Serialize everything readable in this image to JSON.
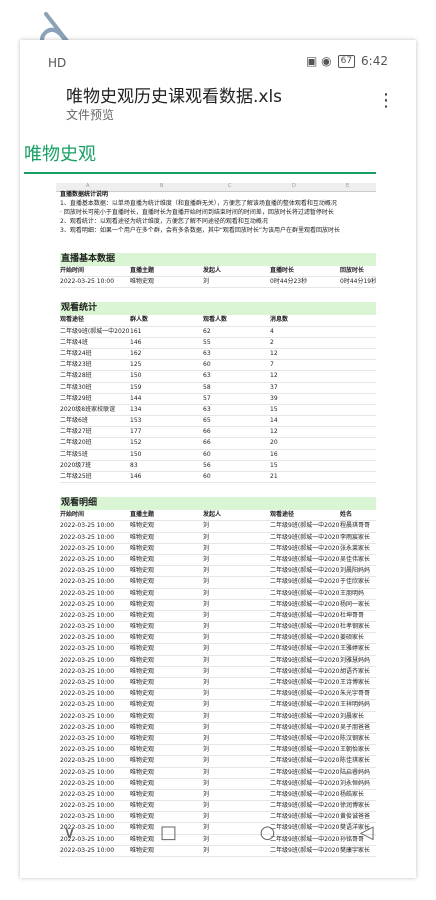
{
  "status": {
    "left": "HD",
    "right_icons": "▣ ◉",
    "battery": "67",
    "time": "6:42"
  },
  "header": {
    "title": "唯物史观历史课观看数据.xls",
    "subtitle": "文件预览",
    "more": "⋮"
  },
  "sheet": {
    "name": "唯物史观",
    "columns": [
      "A",
      "B",
      "C",
      "D",
      "E",
      "F"
    ]
  },
  "notes": {
    "title": "直播数据统计说明",
    "lines": [
      "1、直播基本数据：以单场直播为统计维度（和直播群无关），方便您了解该场直播的整体观看和互动概况",
      "· 回放时长可能小于直播时长，直播时长为直播开始时间到结束时间的时间差，回放时长将过滤暂停时长",
      "2、观看统计：以观看途径为统计维度，方便您了解不同途径的观看和互动概况",
      "3、观看明细：如果一个用户在多个群，会有多条数据，其中“观看回放时长”为该用户在群里观看回放时长"
    ]
  },
  "basic": {
    "section": "直播基本数据",
    "headers": [
      "开始时间",
      "直播主题",
      "发起人",
      "直播时长",
      "回放时长"
    ],
    "row": [
      "2022-03-25 10:00",
      "唯物史观",
      "刘",
      "0时44分23秒",
      "0时44分19秒"
    ]
  },
  "stats": {
    "section": "观看统计",
    "headers": [
      "观看途径",
      "群人数",
      "观看人数",
      "消息数"
    ],
    "rows": [
      [
        "二年级9班(郝城一中2020)",
        "161",
        "62",
        "4"
      ],
      [
        "二年级4班",
        "146",
        "55",
        "2"
      ],
      [
        "二年级24班",
        "162",
        "63",
        "12"
      ],
      [
        "二年级23班",
        "125",
        "60",
        "7"
      ],
      [
        "二年级28班",
        "150",
        "63",
        "12"
      ],
      [
        "二年级30班",
        "159",
        "58",
        "37"
      ],
      [
        "二年级29班",
        "144",
        "57",
        "39"
      ],
      [
        "2020级8班家校联谊",
        "134",
        "63",
        "15"
      ],
      [
        "二年级6班",
        "153",
        "65",
        "14"
      ],
      [
        "二年级27班",
        "177",
        "66",
        "12"
      ],
      [
        "二年级20班",
        "152",
        "66",
        "20"
      ],
      [
        "二年级5班",
        "150",
        "60",
        "16"
      ],
      [
        "2020级7班",
        "83",
        "56",
        "15"
      ],
      [
        "二年级25班",
        "146",
        "60",
        "21"
      ]
    ]
  },
  "detail": {
    "section": "观看明细",
    "headers": [
      "开始时间",
      "直播主题",
      "发起人",
      "观看途径",
      "姓名"
    ],
    "rows": [
      [
        "2022-03-25 10:00",
        "唯物史观",
        "刘",
        "二年级9班(郝城一中2020)",
        "程晨琪哥哥"
      ],
      [
        "2022-03-25 10:00",
        "唯物史观",
        "刘",
        "二年级9班(郝城一中2020)",
        "李雨宸家长"
      ],
      [
        "2022-03-25 10:00",
        "唯物史观",
        "刘",
        "二年级9班(郝城一中2020)",
        "张永莱家长"
      ],
      [
        "2022-03-25 10:00",
        "唯物史观",
        "刘",
        "二年级9班(郝城一中2020)",
        "吴佳伟家长"
      ],
      [
        "2022-03-25 10:00",
        "唯物史观",
        "刘",
        "二年级9班(郝城一中2020)",
        "刘晨阳妈妈"
      ],
      [
        "2022-03-25 10:00",
        "唯物史观",
        "刘",
        "二年级9班(郝城一中2020)",
        "于佳欣家长"
      ],
      [
        "2022-03-25 10:00",
        "唯物史观",
        "刘",
        "二年级9班(郝城一中2020)",
        "王朋明妈"
      ],
      [
        "2022-03-25 10:00",
        "唯物史观",
        "刘",
        "二年级9班(郝城一中2020)",
        "杨同一家长"
      ],
      [
        "2022-03-25 10:00",
        "唯物史观",
        "刘",
        "二年级9班(郝城一中2020)",
        "杜坤哥哥"
      ],
      [
        "2022-03-25 10:00",
        "唯物史观",
        "刘",
        "二年级9班(郝城一中2020)",
        "杜孝钢家长"
      ],
      [
        "2022-03-25 10:00",
        "唯物史观",
        "刘",
        "二年级9班(郝城一中2020)",
        "姜硕家长"
      ],
      [
        "2022-03-25 10:00",
        "唯物史观",
        "刘",
        "二年级9班(郝城一中2020)",
        "王雅婷家长"
      ],
      [
        "2022-03-25 10:00",
        "唯物史观",
        "刘",
        "二年级9班(郝城一中2020)",
        "刘雅慧妈妈"
      ],
      [
        "2022-03-25 10:00",
        "唯物史观",
        "刘",
        "二年级9班(郝城一中2020)",
        "胡语齐家长"
      ],
      [
        "2022-03-25 10:00",
        "唯物史观",
        "刘",
        "二年级9班(郝城一中2020)",
        "王诗博家长"
      ],
      [
        "2022-03-25 10:00",
        "唯物史观",
        "刘",
        "二年级9班(郝城一中2020)",
        "朱光宇哥哥"
      ],
      [
        "2022-03-25 10:00",
        "唯物史观",
        "刘",
        "二年级9班(郝城一中2020)",
        "王祥明妈妈"
      ],
      [
        "2022-03-25 10:00",
        "唯物史观",
        "刘",
        "二年级9班(郝城一中2020)",
        "刘晨家长"
      ],
      [
        "2022-03-25 10:00",
        "唯物史观",
        "刘",
        "二年级9班(郝城一中2020)",
        "吴子朋爸爸"
      ],
      [
        "2022-03-25 10:00",
        "唯物史观",
        "刘",
        "二年级9班(郝城一中2020)",
        "陈汉钢家长"
      ],
      [
        "2022-03-25 10:00",
        "唯物史观",
        "刘",
        "二年级9班(郝城一中2020)",
        "王朝怡家长"
      ],
      [
        "2022-03-25 10:00",
        "唯物史观",
        "刘",
        "二年级9班(郝城一中2020)",
        "陈佳琪家长"
      ],
      [
        "2022-03-25 10:00",
        "唯物史观",
        "刘",
        "二年级9班(郝城一中2020)",
        "陆启睿妈妈"
      ],
      [
        "2022-03-25 10:00",
        "唯物史观",
        "刘",
        "二年级9班(郝城一中2020)",
        "刘永恒妈妈"
      ],
      [
        "2022-03-25 10:00",
        "唯物史观",
        "刘",
        "二年级9班(郝城一中2020)",
        "杨皓家长"
      ],
      [
        "2022-03-25 10:00",
        "唯物史观",
        "刘",
        "二年级9班(郝城一中2020)",
        "徐润博家长"
      ],
      [
        "2022-03-25 10:00",
        "唯物史观",
        "刘",
        "二年级9班(郝城一中2020)",
        "黄俊诚爸爸"
      ],
      [
        "2022-03-25 10:00",
        "唯物史观",
        "刘",
        "二年级9班(郝城一中2020)",
        "樊语洋家长"
      ],
      [
        "2022-03-25 10:00",
        "唯物史观",
        "刘",
        "二年级9班(郝城一中2020)",
        "孙铭哥哥"
      ],
      [
        "2022-03-25 10:00",
        "唯物史观",
        "刘",
        "二年级9班(郝城一中2020)",
        "樊康宇家长"
      ]
    ]
  },
  "nav": {
    "back": "∨",
    "home": "□",
    "circle": "○",
    "recent": "◁"
  },
  "colors": {
    "green": "#16a064",
    "section_bg": "#d9f5d4"
  }
}
